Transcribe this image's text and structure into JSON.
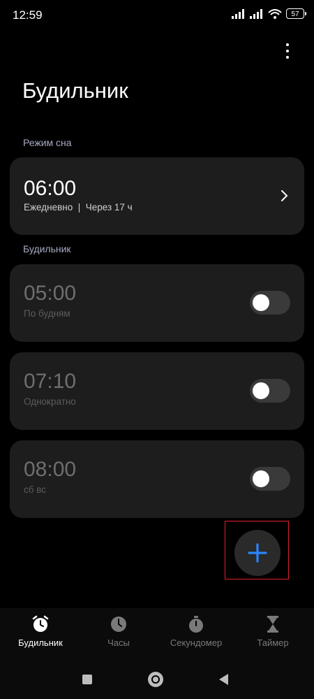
{
  "status": {
    "time": "12:59",
    "battery": "57"
  },
  "header": {
    "title": "Будильник"
  },
  "sleep": {
    "section_label": "Режим сна",
    "time": "06:00",
    "subtitle": "Ежедневно  |  Через 17 ч"
  },
  "alarms_section_label": "Будильник",
  "alarms": [
    {
      "time": "05:00",
      "subtitle": "По будням",
      "enabled": false
    },
    {
      "time": "07:10",
      "subtitle": "Однократно",
      "enabled": false
    },
    {
      "time": "08:00",
      "subtitle": "сб вс",
      "enabled": false
    }
  ],
  "nav": [
    {
      "label": "Будильник",
      "icon": "alarm-clock-icon",
      "active": true
    },
    {
      "label": "Часы",
      "icon": "clock-icon",
      "active": false
    },
    {
      "label": "Секундомер",
      "icon": "stopwatch-icon",
      "active": false
    },
    {
      "label": "Таймер",
      "icon": "hourglass-icon",
      "active": false
    }
  ],
  "colors": {
    "accent": "#2a86ff",
    "card": "#1d1d1d",
    "highlight": "#e0202a"
  }
}
